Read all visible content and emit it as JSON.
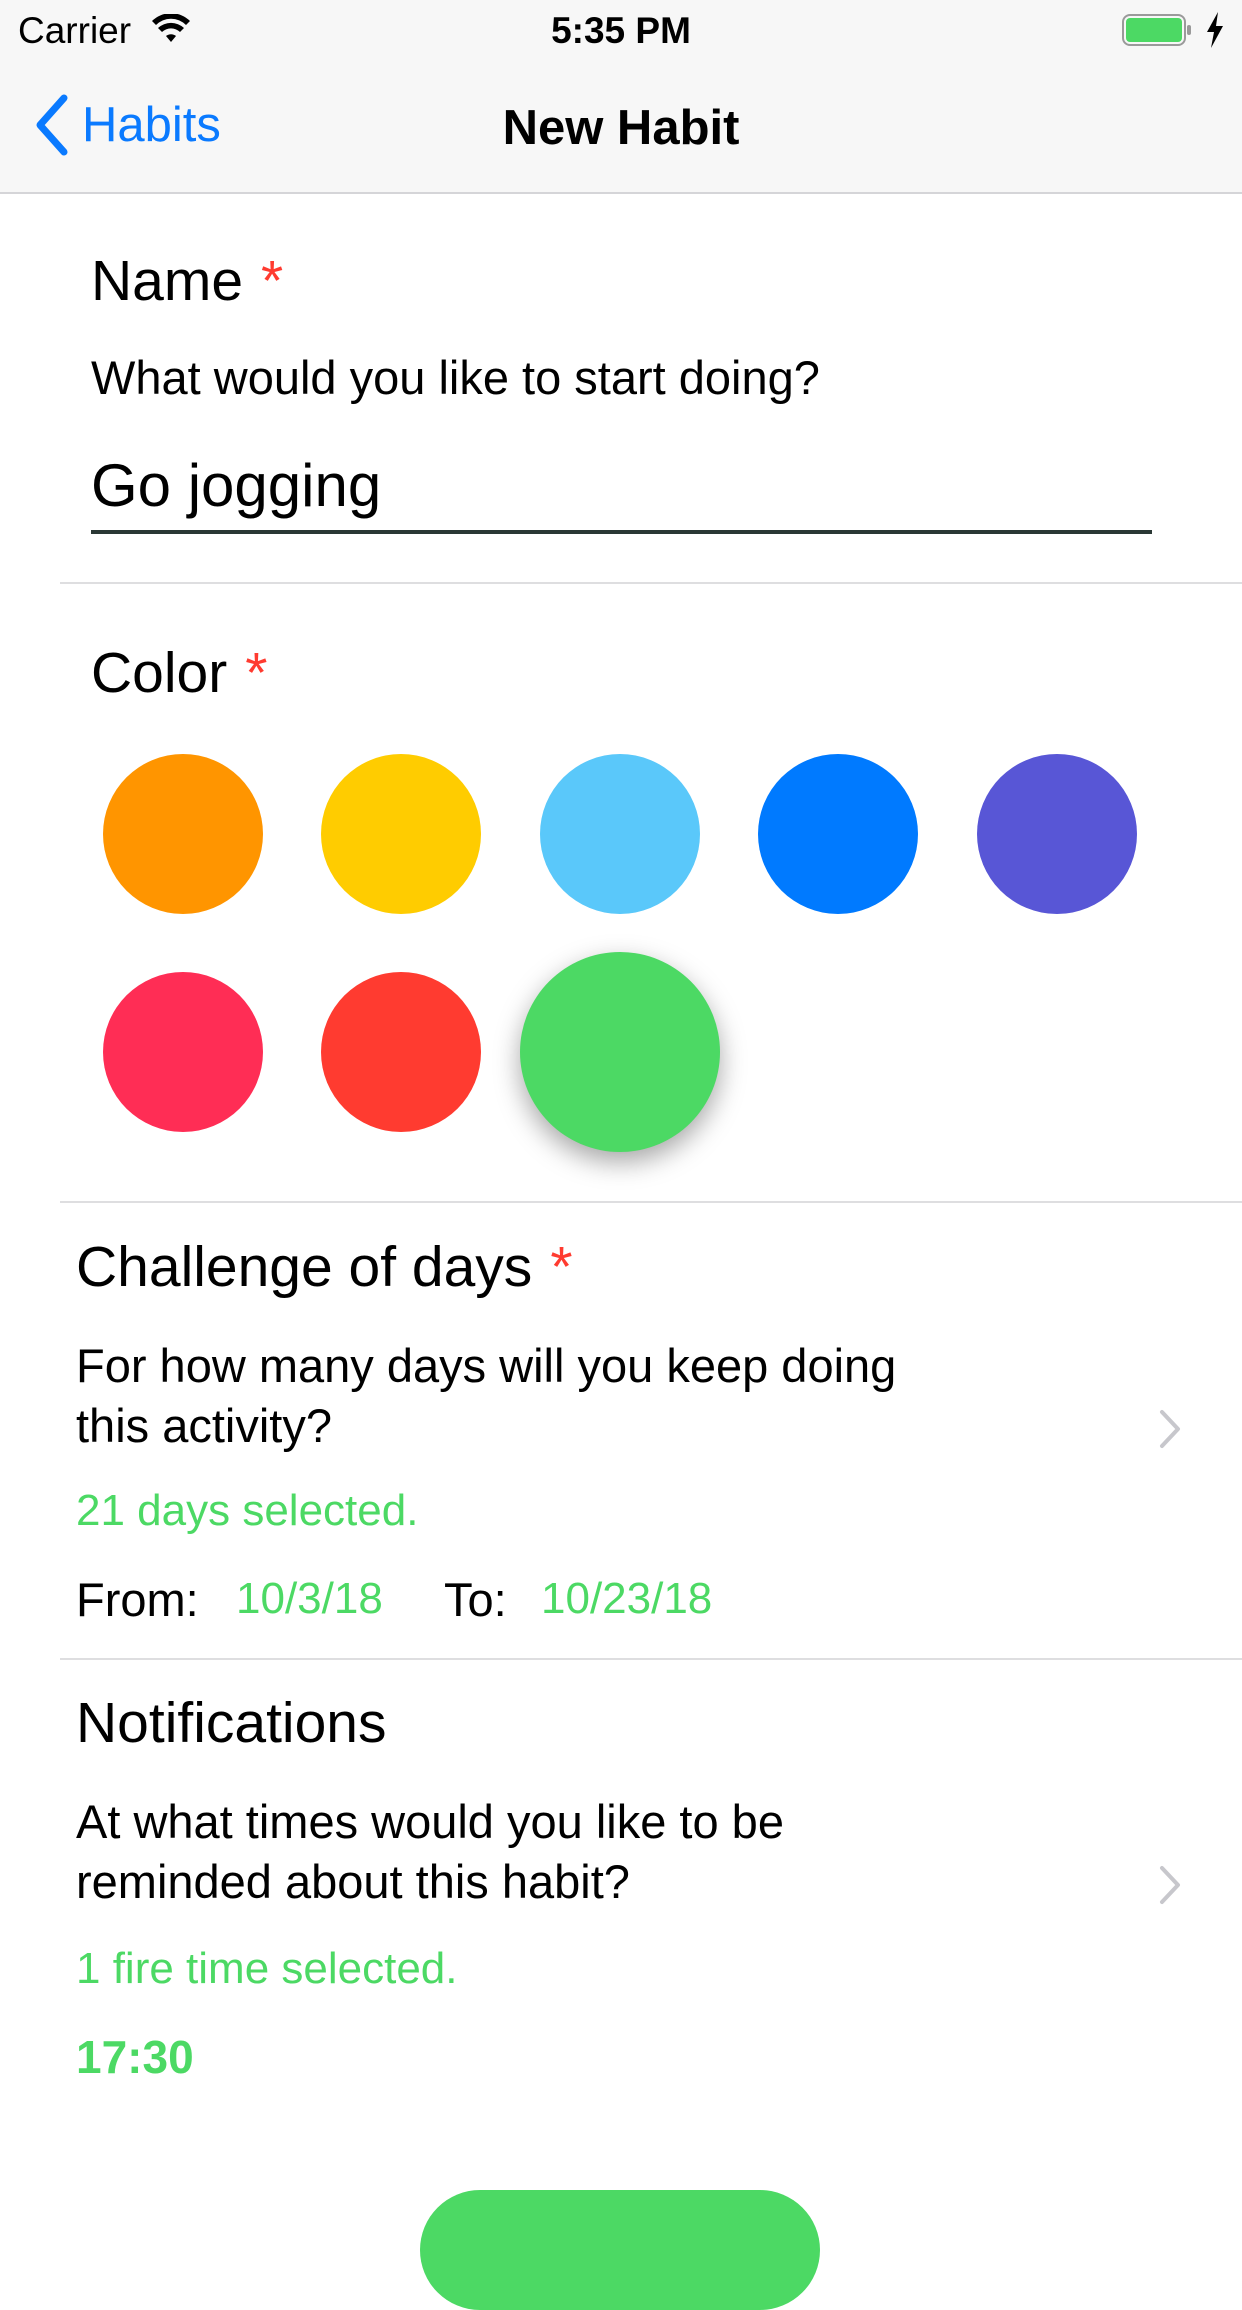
{
  "status_bar": {
    "carrier": "Carrier",
    "time": "5:35 PM"
  },
  "nav": {
    "back_label": "Habits",
    "title": "New Habit"
  },
  "name_section": {
    "title": "Name",
    "required": "*",
    "description": "What would you like to start doing?",
    "input_value": "Go jogging"
  },
  "color_section": {
    "title": "Color",
    "required": "*",
    "swatches": [
      "#ff9500",
      "#ffcc00",
      "#5ac8fa",
      "#007aff",
      "#5856d6",
      "#ff2d55",
      "#ff3b30",
      "#4cd964"
    ],
    "selected_color": "#4cd964"
  },
  "challenge_section": {
    "title": "Challenge of days",
    "required": "*",
    "description_line1": "For how many days will you keep doing",
    "description_line2": "this activity?",
    "days_selected": "21 days selected.",
    "from_label": "From:",
    "from_value": "10/3/18",
    "to_label": "To:",
    "to_value": "10/23/18"
  },
  "notifications_section": {
    "title": "Notifications",
    "description_line1": "At what times would you like to be",
    "description_line2": "reminded about this habit?",
    "fire_time_selected": "1 fire time selected.",
    "time_value": "17:30"
  },
  "colors": {
    "accent_blue": "#0a7aff",
    "accent_green": "#4cd964",
    "required_red": "#ff3b30"
  }
}
